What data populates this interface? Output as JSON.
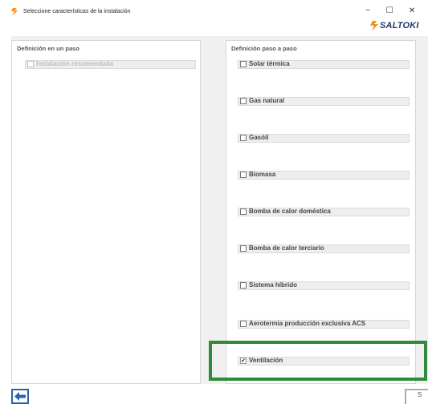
{
  "window": {
    "title": "Seleccione características de la instalación",
    "minimize_glyph": "−",
    "maximize_glyph": "☐",
    "close_glyph": "✕"
  },
  "brand": {
    "logo_text": "SALTOKI",
    "accent_color": "#f28c1b",
    "text_color": "#1f3a6e"
  },
  "left_panel": {
    "title": "Definición en un paso",
    "options": [
      {
        "label": "Instalación recomendada",
        "checked": false,
        "enabled": false
      }
    ]
  },
  "right_panel": {
    "title": "Definición paso a paso",
    "options": [
      {
        "label": "Solar térmica",
        "checked": false
      },
      {
        "label": "Gas natural",
        "checked": false
      },
      {
        "label": "Gasóil",
        "checked": false
      },
      {
        "label": "Biomasa",
        "checked": false
      },
      {
        "label": "Bomba de calor doméstica",
        "checked": false
      },
      {
        "label": "Bomba de calor terciario",
        "checked": false
      },
      {
        "label": "Sistema híbrido",
        "checked": false
      },
      {
        "label": "Aerotermia producción exclusiva ACS",
        "checked": false
      },
      {
        "label": "Ventilación",
        "checked": true
      }
    ]
  },
  "highlight_color": "#2f8a3c",
  "navigation": {
    "back_icon": "arrow-left-icon",
    "next_label": "S"
  }
}
